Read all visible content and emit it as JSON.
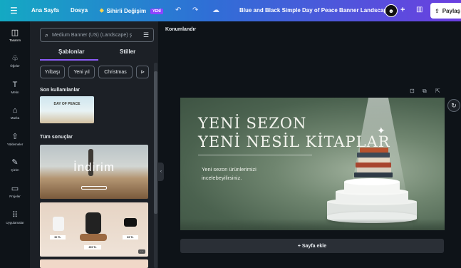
{
  "topbar": {
    "home": "Ana Sayfa",
    "file": "Dosya",
    "magic": "Sihirli Değişim",
    "magic_badge": "YENİ",
    "doc_title": "Blue and Black Simple Day of Peace Banner Landscape",
    "share": "Paylaş"
  },
  "rail": {
    "items": [
      {
        "label": "Tasarım",
        "icon": "layout-icon"
      },
      {
        "label": "Öğeler",
        "icon": "shapes-icon"
      },
      {
        "label": "Metin",
        "icon": "text-icon"
      },
      {
        "label": "Marka",
        "icon": "brand-icon"
      },
      {
        "label": "Yüklemeler",
        "icon": "upload-icon"
      },
      {
        "label": "Çizim",
        "icon": "draw-icon"
      },
      {
        "label": "Projeler",
        "icon": "folder-icon"
      },
      {
        "label": "Uygulamalar",
        "icon": "apps-icon"
      }
    ]
  },
  "panel": {
    "search_placeholder": "Medium Banner (US) (Landscape) ş",
    "tab_templates": "Şablonlar",
    "tab_styles": "Stiller",
    "chips": [
      "Yılbaşı",
      "Yeni yıl",
      "Christmas"
    ],
    "recent_title": "Son kullanılanlar",
    "recent_thumb_title": "DAY OF PEACE",
    "recent_thumb_sub": "",
    "all_results_title": "Tüm sonuçlar",
    "thumb2_text": "İndirim",
    "thumb3_prices": [
      "90 TL",
      "299 TL",
      "89 TL"
    ]
  },
  "canvas": {
    "location": "Konumlandır",
    "headline1": "YENİ SEZON",
    "headline2": "YENİ NESİL KİTAPLAR",
    "paragraph": "Yeni sezon ürünlerimizi incelebeyilirsiniz.",
    "add_page": "+ Sayfa ekle"
  },
  "colors": {
    "accent": "#8b5cf6",
    "banner_green": "#4b624f"
  }
}
